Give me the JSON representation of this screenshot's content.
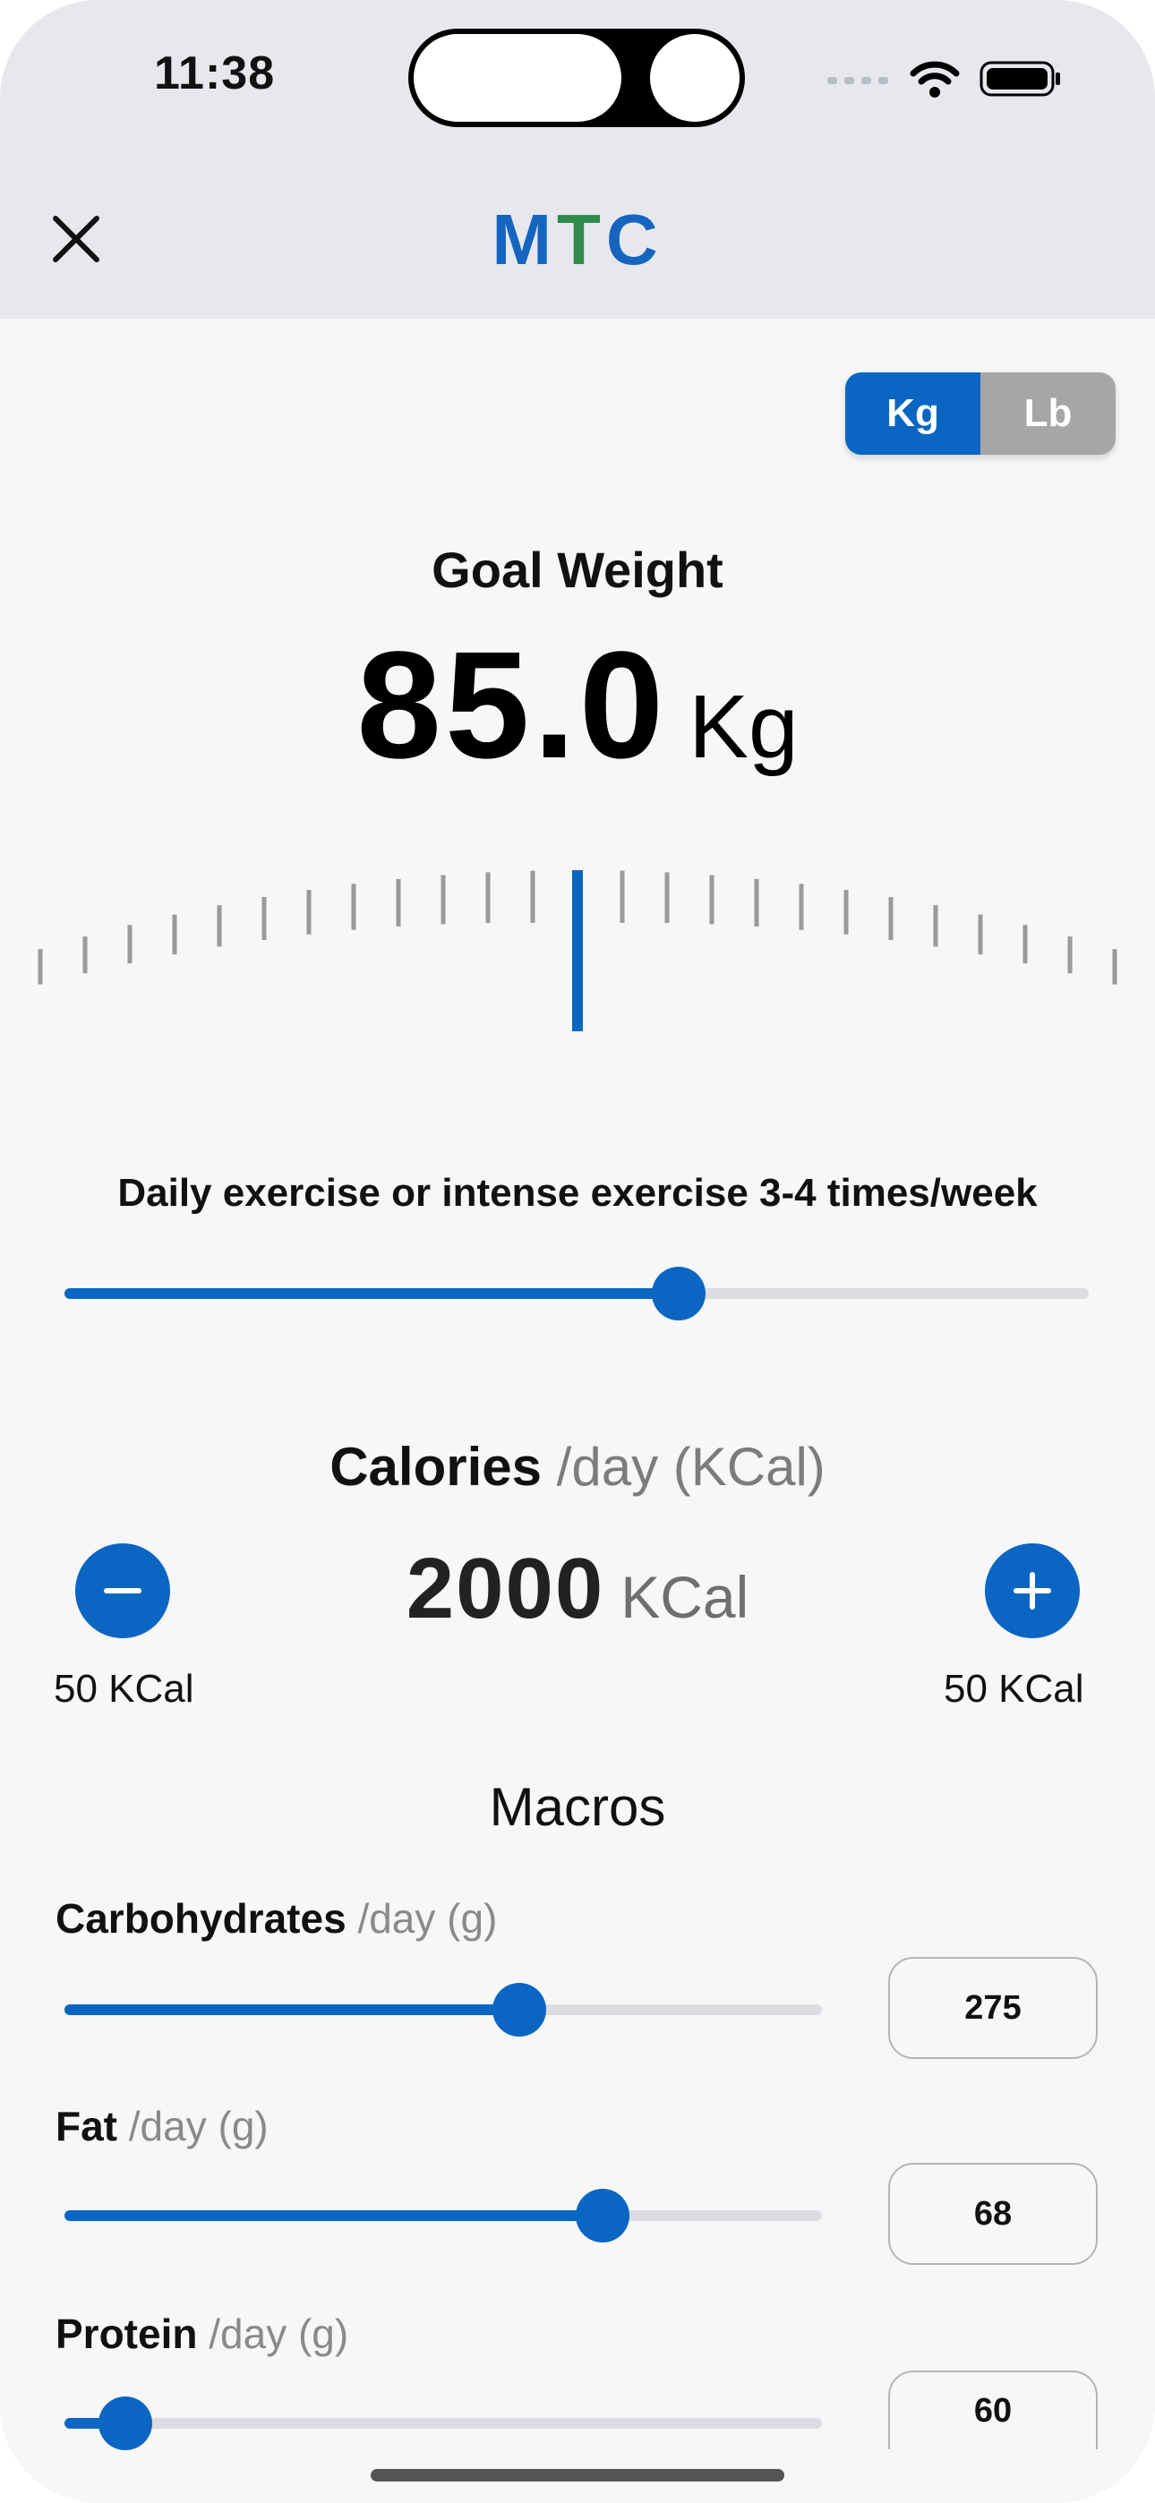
{
  "status_bar": {
    "time": "11:38"
  },
  "header": {
    "brand_m": "M",
    "brand_t": "T",
    "brand_c": "C"
  },
  "unit_toggle": {
    "options": [
      "Kg",
      "Lb"
    ],
    "selected": "Kg"
  },
  "goal": {
    "label": "Goal Weight",
    "value": "85.0",
    "unit": "Kg"
  },
  "activity": {
    "label": "Daily exercise or intense exercise 3-4 times/week",
    "slider_fraction": 0.6
  },
  "calories": {
    "label": "Calories",
    "label_sub": "/day (KCal)",
    "value": "2000",
    "unit": "KCal",
    "decrement_label": "50 KCal",
    "increment_label": "50 KCal"
  },
  "macros": {
    "title": "Macros",
    "items": [
      {
        "label": "Carbohydrates",
        "sub": "/day (g)",
        "value": "275",
        "fraction": 0.6
      },
      {
        "label": "Fat",
        "sub": "/day (g)",
        "value": "68",
        "fraction": 0.71
      },
      {
        "label": "Protein",
        "sub": "/day (g)",
        "value": "60",
        "fraction": 0.08
      }
    ]
  },
  "colors": {
    "accent": "#0a66c2",
    "brand_green": "#2e8b4a",
    "header_bg": "#e6e8ee"
  }
}
